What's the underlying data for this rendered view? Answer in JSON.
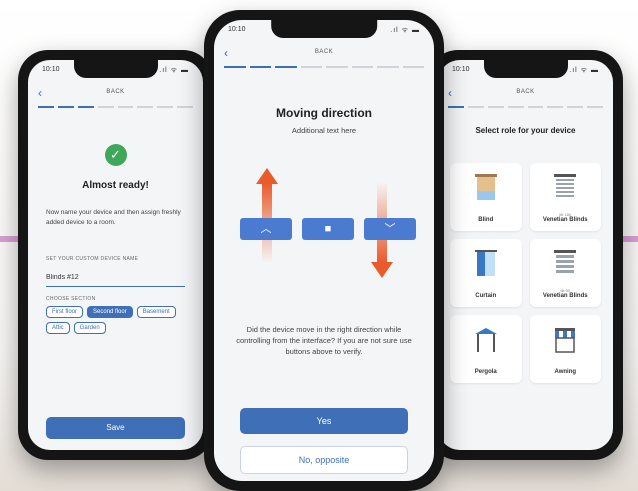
{
  "colors": {
    "accent": "#3f6fb7",
    "arrow": "#ea5b2c",
    "success": "#3ea85a",
    "decor_line": "#d9a0d6"
  },
  "left_phone": {
    "status_time": "10:10",
    "status_icons": ".ıl ᯤ ▬",
    "back_label": "BACK",
    "progress": {
      "total": 8,
      "completed": 3
    },
    "title": "Almost ready!",
    "description": "Now name your device and then assign freshly added device to a room.",
    "name_field_label": "SET YOUR CUSTOM DEVICE NAME",
    "name_field_value": "Blinds #12",
    "section_label": "CHOOSE SECTION",
    "sections": [
      {
        "label": "First floor",
        "selected": false
      },
      {
        "label": "Second floor",
        "selected": true
      },
      {
        "label": "Basement",
        "selected": false
      },
      {
        "label": "Attic",
        "selected": false
      },
      {
        "label": "Garden",
        "selected": false
      }
    ],
    "save_label": "Save"
  },
  "center_phone": {
    "status_time": "10:10",
    "status_icons": ".ıl ᯤ ▬",
    "back_label": "BACK",
    "progress": {
      "total": 8,
      "completed": 3
    },
    "title": "Moving direction",
    "subtitle": "Additional text here",
    "controls": {
      "up": "︿",
      "stop": "■",
      "down": "﹀"
    },
    "question": "Did the device move in the right direction while controlling from the interface? If you are not sure use buttons above to verify.",
    "yes_label": "Yes",
    "no_label": "No, opposite"
  },
  "right_phone": {
    "status_time": "10:10",
    "status_icons": ".ıl ᯤ ▬",
    "back_label": "BACK",
    "title": "Select role for your device",
    "roles": [
      {
        "name": "Blind",
        "sub": "",
        "icon": "blind-icon"
      },
      {
        "name": "Venetian Blinds",
        "sub": "tilt 180",
        "icon": "venetian-blinds-icon"
      },
      {
        "name": "Curtain",
        "sub": "",
        "icon": "curtain-icon"
      },
      {
        "name": "Venetian Blinds",
        "sub": "tilt 90",
        "icon": "venetian-blinds-icon"
      },
      {
        "name": "Pergola",
        "sub": "",
        "icon": "pergola-icon"
      },
      {
        "name": "Awning",
        "sub": "",
        "icon": "awning-icon"
      }
    ]
  }
}
